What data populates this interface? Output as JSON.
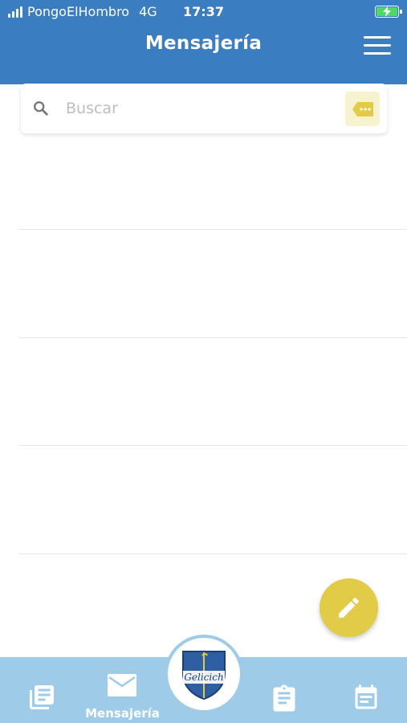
{
  "status_bar": {
    "carrier": "PongoElHombro",
    "network": "4G",
    "time": "17:37"
  },
  "header": {
    "title": "Mensajería"
  },
  "search": {
    "placeholder": "Buscar"
  },
  "messages": {
    "rows": [
      "",
      "",
      "",
      ""
    ]
  },
  "bottom_nav": {
    "items": [
      {
        "icon": "newspaper-icon",
        "label": ""
      },
      {
        "icon": "mail-icon",
        "label": "Mensajería",
        "active": true
      },
      {
        "icon": "school-logo",
        "label": ""
      },
      {
        "icon": "clipboard-icon",
        "label": ""
      },
      {
        "icon": "calendar-icon",
        "label": ""
      }
    ],
    "logo_text": "Gelicich"
  },
  "colors": {
    "primary": "#3b7dc1",
    "accent": "#e2cb47",
    "nav_bg": "#9ecbe7",
    "tag_bg": "#f7f2cf",
    "battery": "#4cd964"
  }
}
